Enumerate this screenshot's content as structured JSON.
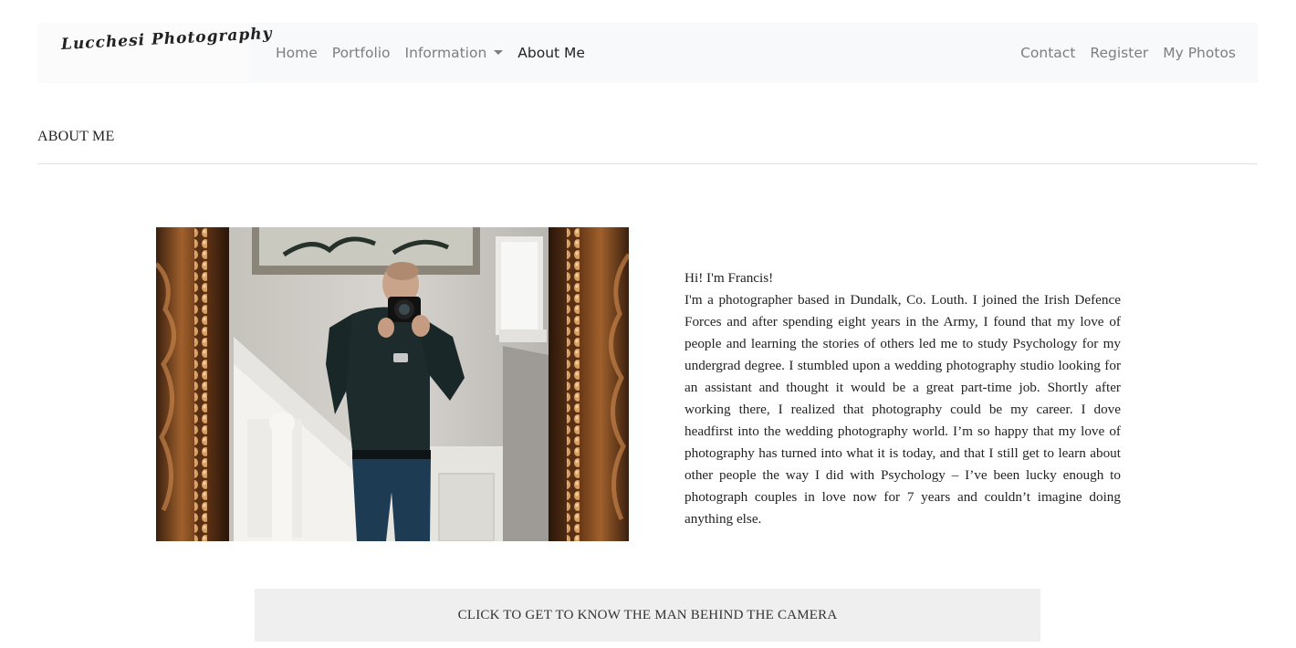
{
  "navbar": {
    "brand": "Lucchesi Photography",
    "left_links": [
      {
        "label": "Home"
      },
      {
        "label": "Portfolio"
      },
      {
        "label": "Information"
      },
      {
        "label": "About Me"
      }
    ],
    "right_links": [
      {
        "label": "Contact"
      },
      {
        "label": "Register"
      },
      {
        "label": "My Photos"
      }
    ]
  },
  "page": {
    "title": "ABOUT ME"
  },
  "bio": {
    "greeting": "Hi! I'm Francis!",
    "body": "I'm a photographer based in Dundalk, Co. Louth. I joined the Irish Defence Forces and after spending eight years in the Army, I found that my love of people and learning the stories of others led me to study Psychology for my undergrad degree. I stumbled upon a wedding photography studio looking for an assistant and thought it would be a great part-time job. Shortly after working there, I realized that photography could be my career. I dove headfirst into the wedding photography world. I’m so happy that my love of photography has turned into what it is today, and that I still get to learn about other people the way I did with Psychology – I’ve been lucky enough to photograph couples in love now for 7 years and couldn’t imagine doing anything else."
  },
  "cta": {
    "label": "CLICK TO GET TO KNOW THE MAN BEHIND THE CAMERA"
  },
  "colors": {
    "navbar_bg": "#f8f9fa",
    "nav_link": "#7b7f83",
    "nav_active": "#212529",
    "cta_bg": "#efefef"
  }
}
